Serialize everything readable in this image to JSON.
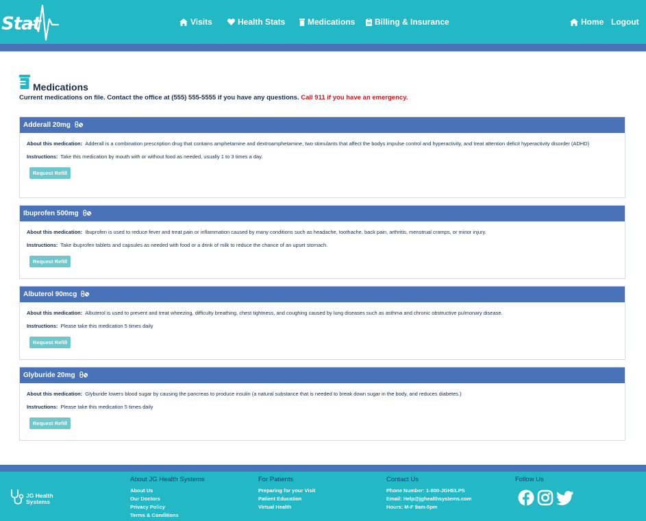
{
  "brand": {
    "logo_text": "Stat"
  },
  "nav": {
    "left": [
      {
        "label": "Visits",
        "icon": "home-icon"
      },
      {
        "label": "Health Stats",
        "icon": "heart-icon"
      },
      {
        "label": "Medications",
        "icon": "pill-bottle-icon"
      },
      {
        "label": "Billing & Insurance",
        "icon": "clipboard-icon"
      }
    ],
    "home_label": "Home",
    "logout_label": "Logout"
  },
  "page": {
    "title": "Medications",
    "intro": "Current medications on file. Contact the office at (555) 555-5555 if you have any questions.",
    "emergency": "Call 911 if you have an emergency."
  },
  "labels": {
    "about": "About this medication:",
    "instructions": "Instructions:",
    "refill_button": "Request Refill"
  },
  "medications": [
    {
      "name": "Adderall 20mg",
      "about": "Adderall is a combination prescription drug that contains amphetamine and dextroamphetamine, two stimulants that affect the bodys impulse control and hyperactivity, and treat attention deficit hyperactivity disorder (ADHD)",
      "instructions": "Take this medication by mouth with or without food as needed, usually 1 to 3 times a day."
    },
    {
      "name": "Ibuprofen 500mg",
      "about": "Ibuprofen is used to reduce fever and treat pain or inflammation caused by many conditions such as headache, toothache, back pain, arthritis, menstrual cramps, or minor injury.",
      "instructions": "Take ibuprofen tablets and capsules as needed with food or a drink of milk to reduce the chance of an upset stomach."
    },
    {
      "name": "Albuterol 90mcg",
      "about": "Albuterol is used to prevent and treat wheezing, difficulty breathing, chest tightness, and coughing caused by lung diseases such as asthma and chronic obstructive pulmonary disease.",
      "instructions": "Please take this medication 5 times daily"
    },
    {
      "name": "Glyburide 20mg",
      "about": "Glyburide lowers blood sugar by causing the pancreas to produce insulin (a natural substance that is needed to break down sugar in the body, and reduces diabetes.)",
      "instructions": "Please take this medication 5 times daily"
    }
  ],
  "footer": {
    "logo_line1": "JG Health",
    "logo_line2": "Systems",
    "about": {
      "heading": "About JG Health Systems",
      "links": [
        "About Us",
        "Our Doctors",
        "Privacy Policy",
        "Terms & Conditions"
      ]
    },
    "patients": {
      "heading": "For Patients",
      "links": [
        "Preparing for your Visit",
        "Patient Education",
        "Virtual Health"
      ]
    },
    "contact": {
      "heading": "Contact Us",
      "phone": "Phone Number: 1-800-JGHELPS",
      "email": "Email: Help@jghealthsystems.com",
      "hours": "Hours: M-F 9am-5pm"
    },
    "follow": {
      "heading": "Follow Us",
      "icons": [
        "facebook-icon",
        "instagram-icon",
        "twitter-icon"
      ]
    }
  },
  "colors": {
    "nav_bg": "#22b8c6",
    "accent_blue": "#4a72b8",
    "emergency_red": "#d0141b",
    "refill_button": "#6dc7cc"
  }
}
